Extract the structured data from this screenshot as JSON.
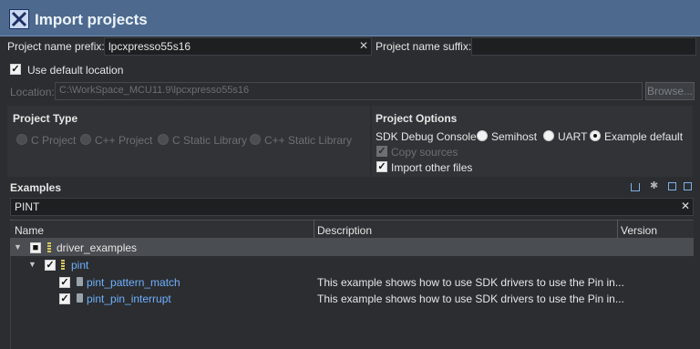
{
  "title": "Import projects",
  "prefix": {
    "label": "Project name prefix:",
    "value": "lpcxpresso55s16"
  },
  "suffix": {
    "label": "Project name suffix:",
    "value": ""
  },
  "use_default_location": {
    "label": "Use default location",
    "checked": true
  },
  "location": {
    "label": "Location:",
    "value": "C:\\WorkSpace_MCU11.9\\lpcxpresso55s16",
    "browse_label": "Browse..."
  },
  "project_type": {
    "header": "Project Type",
    "options": [
      "C Project",
      "C++ Project",
      "C Static Library",
      "C++ Static Library"
    ]
  },
  "project_options": {
    "header": "Project Options",
    "sdk_debug_console_label": "SDK Debug Console",
    "console_options": [
      "Semihost",
      "UART",
      "Example default"
    ],
    "selected_console": "Example default",
    "copy_sources_label": "Copy sources",
    "import_other_files_label": "Import other files"
  },
  "examples": {
    "header": "Examples",
    "filter_value": "PINT",
    "columns": [
      "Name",
      "Description",
      "Version"
    ],
    "tree": [
      {
        "name": "driver_examples",
        "description": "",
        "level": 0,
        "checked": true
      },
      {
        "name": "pint",
        "description": "",
        "level": 1,
        "checked": true
      },
      {
        "name": "pint_pattern_match",
        "description": "This example shows how to use SDK drivers to use the Pin in...",
        "level": 2,
        "checked": true
      },
      {
        "name": "pint_pin_interrupt",
        "description": "This example shows how to use SDK drivers to use the Pin in...",
        "level": 2,
        "checked": true
      }
    ]
  },
  "icons": {
    "title": "import-x-icon",
    "clear": "close-icon",
    "toolbar": [
      "collapse-all-icon",
      "filter-icon",
      "select-all-icon",
      "deselect-all-icon"
    ]
  }
}
